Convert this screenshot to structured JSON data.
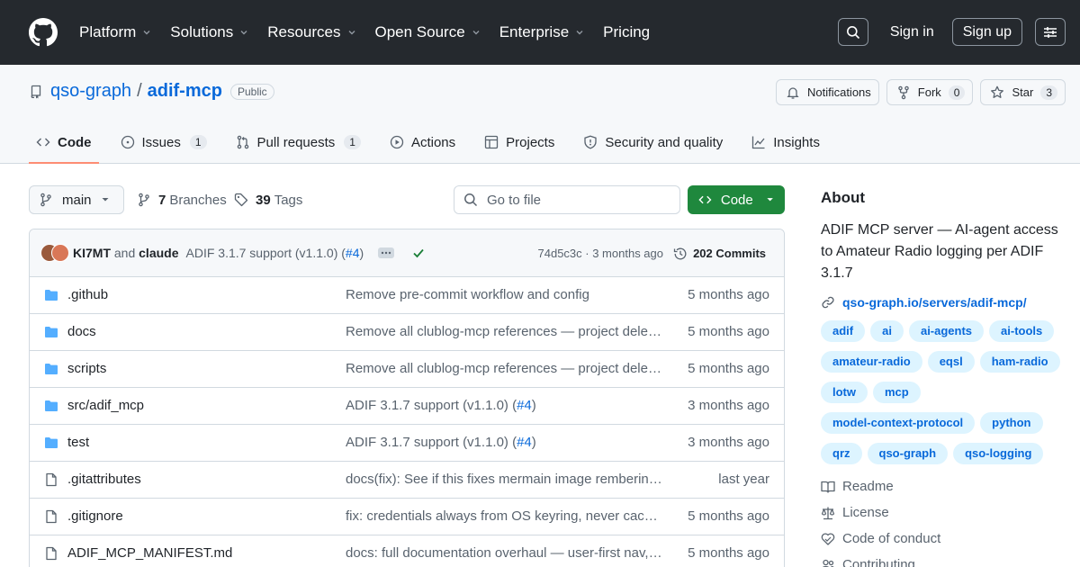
{
  "header": {
    "nav": [
      {
        "label": "Platform",
        "has_caret": true
      },
      {
        "label": "Solutions",
        "has_caret": true
      },
      {
        "label": "Resources",
        "has_caret": true
      },
      {
        "label": "Open Source",
        "has_caret": true
      },
      {
        "label": "Enterprise",
        "has_caret": true
      },
      {
        "label": "Pricing",
        "has_caret": false
      }
    ],
    "sign_in": "Sign in",
    "sign_up": "Sign up",
    "icons": {
      "logo": "github-mark-icon",
      "search": "search-icon",
      "menu": "sliders-menu-icon"
    }
  },
  "repo": {
    "owner": "qso-graph",
    "separator": "/",
    "name": "adif-mcp",
    "visibility": "Public",
    "notifications_label": "Notifications",
    "fork_label": "Fork",
    "fork_count": "0",
    "star_label": "Star",
    "star_count": "3"
  },
  "tabs": [
    {
      "label": "Code",
      "icon": "code-icon",
      "active": true,
      "count": ""
    },
    {
      "label": "Issues",
      "icon": "issue-opened-icon",
      "active": false,
      "count": "1"
    },
    {
      "label": "Pull requests",
      "icon": "git-pull-request-icon",
      "active": false,
      "count": "1"
    },
    {
      "label": "Actions",
      "icon": "play-icon",
      "active": false,
      "count": ""
    },
    {
      "label": "Projects",
      "icon": "table-icon",
      "active": false,
      "count": ""
    },
    {
      "label": "Security and quality",
      "icon": "shield-icon",
      "active": false,
      "count": ""
    },
    {
      "label": "Insights",
      "icon": "graph-icon",
      "active": false,
      "count": ""
    }
  ],
  "toolbar": {
    "branch": "main",
    "branches_count": "7",
    "branches_label": "Branches",
    "tags_count": "39",
    "tags_label": "Tags",
    "goto_placeholder": "Go to file",
    "code_button": "Code"
  },
  "latest_commit": {
    "author1": "KI7MT",
    "and_text": "and",
    "author2": "claude",
    "message": "ADIF 3.1.7 support (v1.1.0) (",
    "pr": "#4",
    "message_end": ")",
    "sha_time": "74d5c3c · 3 months ago",
    "commits_label": "202 Commits"
  },
  "files": [
    {
      "type": "dir",
      "name": ".github",
      "message": "Remove pre-commit workflow and config",
      "pr": "",
      "message_end": "",
      "time": "5 months ago"
    },
    {
      "type": "dir",
      "name": "docs",
      "message": "Remove all clublog-mcp references — project deleted",
      "pr": "",
      "message_end": "",
      "time": "5 months ago"
    },
    {
      "type": "dir",
      "name": "scripts",
      "message": "Remove all clublog-mcp references — project deleted",
      "pr": "",
      "message_end": "",
      "time": "5 months ago"
    },
    {
      "type": "dir",
      "name": "src/adif_mcp",
      "message": "ADIF 3.1.7 support (v1.1.0) (",
      "pr": "#4",
      "message_end": ")",
      "time": "3 months ago"
    },
    {
      "type": "dir",
      "name": "test",
      "message": "ADIF 3.1.7 support (v1.1.0) (",
      "pr": "#4",
      "message_end": ")",
      "time": "3 months ago"
    },
    {
      "type": "file",
      "name": ".gitattributes",
      "message": "docs(fix): See if this fixes mermain image rembering issues",
      "pr": "",
      "message_end": "",
      "time": "last year"
    },
    {
      "type": "file",
      "name": ".gitignore",
      "message": "fix: credentials always from OS keyring, never cached in memory",
      "pr": "",
      "message_end": "",
      "time": "5 months ago"
    },
    {
      "type": "file",
      "name": "ADIF_MCP_MANIFEST.md",
      "message": "docs: full documentation overhaul — user-first nav, updated",
      "pr": "",
      "message_end": "",
      "time": "5 months ago"
    }
  ],
  "about": {
    "heading": "About",
    "description": "ADIF MCP server — AI-agent access to Amateur Radio logging per ADIF 3.1.7",
    "homepage": "qso-graph.io/servers/adif-mcp/",
    "topics": [
      "adif",
      "ai",
      "ai-agents",
      "ai-tools",
      "amateur-radio",
      "eqsl",
      "ham-radio",
      "lotw",
      "mcp",
      "model-context-protocol",
      "python",
      "qrz",
      "qso-graph",
      "qso-logging"
    ],
    "links": [
      {
        "label": "Readme",
        "icon": "book-icon"
      },
      {
        "label": "License",
        "icon": "law-icon"
      },
      {
        "label": "Code of conduct",
        "icon": "code-of-conduct-icon"
      },
      {
        "label": "Contributing",
        "icon": "people-icon"
      }
    ]
  },
  "colors": {
    "header_bg": "#25292e",
    "link": "#0969da",
    "primary_button": "#1f883d",
    "active_tab_underline": "#fd8c73",
    "folder": "#54aeff",
    "topic_bg": "#ddf4ff"
  }
}
